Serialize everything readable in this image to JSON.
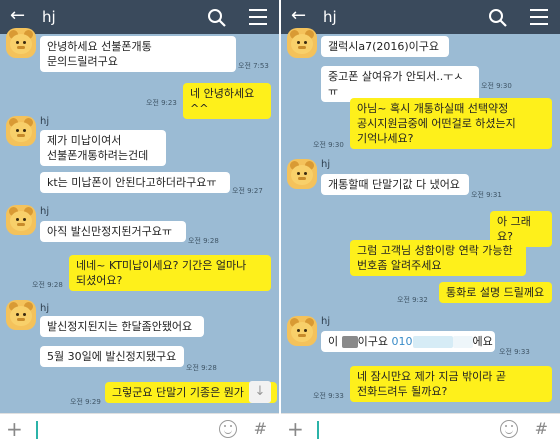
{
  "left": {
    "header": {
      "title": "hj",
      "back": "←",
      "search_icon": "search-icon",
      "menu_icon": "menu-icon"
    },
    "messages": [
      {
        "text": "안녕하세요 선불폰개통\n문의드릴려구요",
        "time": "오전 7:53"
      },
      {
        "text": "네 안녕하세요^^",
        "time": "오전 9:23"
      },
      {
        "name": "hj",
        "text": "제가 미납이여서\n선불폰개통하려는건데"
      },
      {
        "text": "kt는 미납폰이 안된다고하더라구요ㅠ",
        "time": "오전 9:27"
      },
      {
        "name": "hj",
        "text": "아직 발신만정지된거구요ㅠ",
        "time": "오전 9:28"
      },
      {
        "text": "네네~ KT미납이세요? 기간은 얼마나\n되셨어요?",
        "time": "오전 9:28"
      },
      {
        "name": "hj",
        "text": "발신정지된지는 한달좀안됐어요"
      },
      {
        "text": "5월 30일에 발신정지됐구요",
        "time": "오전 9:28"
      },
      {
        "text": "그렇군요 단말기 기종은 뭔가",
        "time": "오전 9:29"
      }
    ],
    "scroll_icon": "↓"
  },
  "right": {
    "header": {
      "title": "hj",
      "back": "←",
      "search_icon": "search-icon",
      "menu_icon": "menu-icon"
    },
    "messages": [
      {
        "text": "갤럭시a7(2016)이구요"
      },
      {
        "text": "중고폰 살여유가 안되서..ㅜㅅㅠ",
        "time": "오전 9:30"
      },
      {
        "text": "아님~ 혹시 개통하실때 선택약정\n공시지원금중에 어떤걸로 하셨는지\n기억나세요?",
        "time": "오전 9:30"
      },
      {
        "name": "hj",
        "text": "개통할때 단말기값 다 냈어요",
        "time": "오전 9:31"
      },
      {
        "text": "아 그래요?"
      },
      {
        "text": "그럼 고객님 성함이랑 연락 가능한\n번호좀 알려주세요"
      },
      {
        "text": "통화로 설명 드릴께요",
        "time": "오전 9:32"
      },
      {
        "name": "hj",
        "text_a": "이",
        "text_b": "이구요",
        "phone": "010",
        "text_c": "에요",
        "time": "오전 9:33"
      },
      {
        "text": "네 잠시만요 제가 지금 밖이라 곧\n전화드려두 될까요?",
        "time": "오전 9:33"
      }
    ]
  },
  "input": {
    "plus": "+",
    "hash": "#"
  },
  "colors": {
    "background": "#9bbbd4",
    "outgoing": "#fef01b",
    "incoming": "#ffffff",
    "header": "#3a4a5c"
  }
}
